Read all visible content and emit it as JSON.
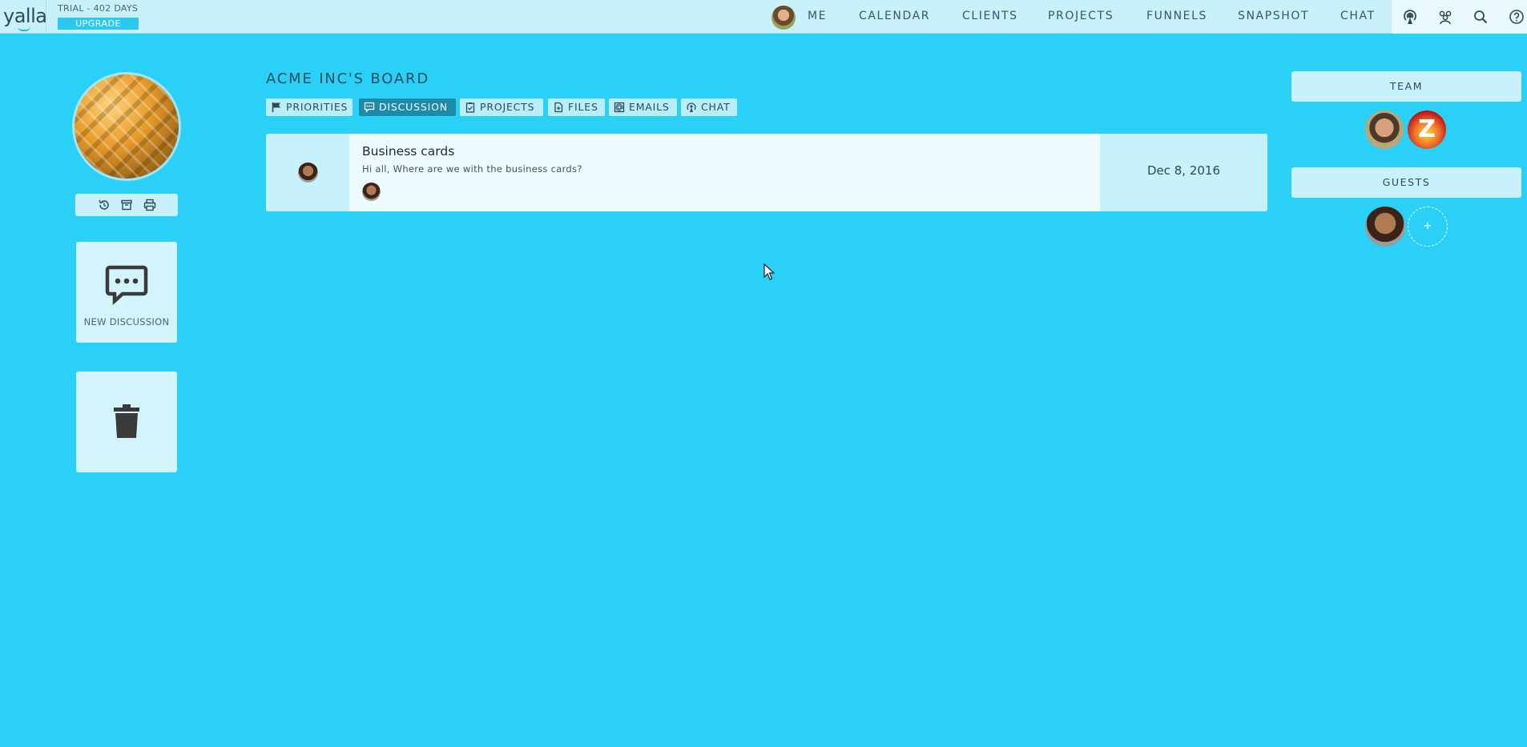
{
  "app": {
    "logo_text": "yalla",
    "trial_text": "TRIAL - 402 DAYS",
    "upgrade_label": "UPGRADE"
  },
  "nav": {
    "items": [
      "ME",
      "CALENDAR",
      "CLIENTS",
      "PROJECTS",
      "FUNNELS",
      "SNAPSHOT",
      "CHAT"
    ],
    "right_icons": [
      "broadcast-icon",
      "team-icon",
      "search-icon",
      "help-icon"
    ]
  },
  "left": {
    "toolbar_icons": [
      "history-icon",
      "archive-icon",
      "print-icon"
    ],
    "new_discussion_label": "NEW DISCUSSION",
    "trash_icon": "trash-icon"
  },
  "board": {
    "title": "ACME INC'S BOARD",
    "tabs": [
      {
        "label": "PRIORITIES",
        "icon": "flag-icon",
        "active": false
      },
      {
        "label": "DISCUSSION",
        "icon": "discussion-icon",
        "active": true
      },
      {
        "label": "PROJECTS",
        "icon": "clipboard-icon",
        "active": false
      },
      {
        "label": "FILES",
        "icon": "file-icon",
        "active": false
      },
      {
        "label": "EMAILS",
        "icon": "email-icon",
        "active": false
      },
      {
        "label": "CHAT",
        "icon": "broadcast-icon",
        "active": false
      }
    ],
    "discussions": [
      {
        "title": "Business cards",
        "snippet": "Hi all, Where are we with the business cards?",
        "date": "Dec 8, 2016"
      }
    ]
  },
  "right": {
    "team_header": "TEAM",
    "guests_header": "GUESTS",
    "team_members": [
      "avatar-member-1",
      "avatar-member-z"
    ],
    "z_initial": "Z",
    "add_guest_symbol": "+"
  },
  "colors": {
    "background": "#2bd0f7",
    "topbar": "#c8f1fc",
    "active_tab": "#1c8aa8",
    "upgrade": "#2bc8f0"
  }
}
